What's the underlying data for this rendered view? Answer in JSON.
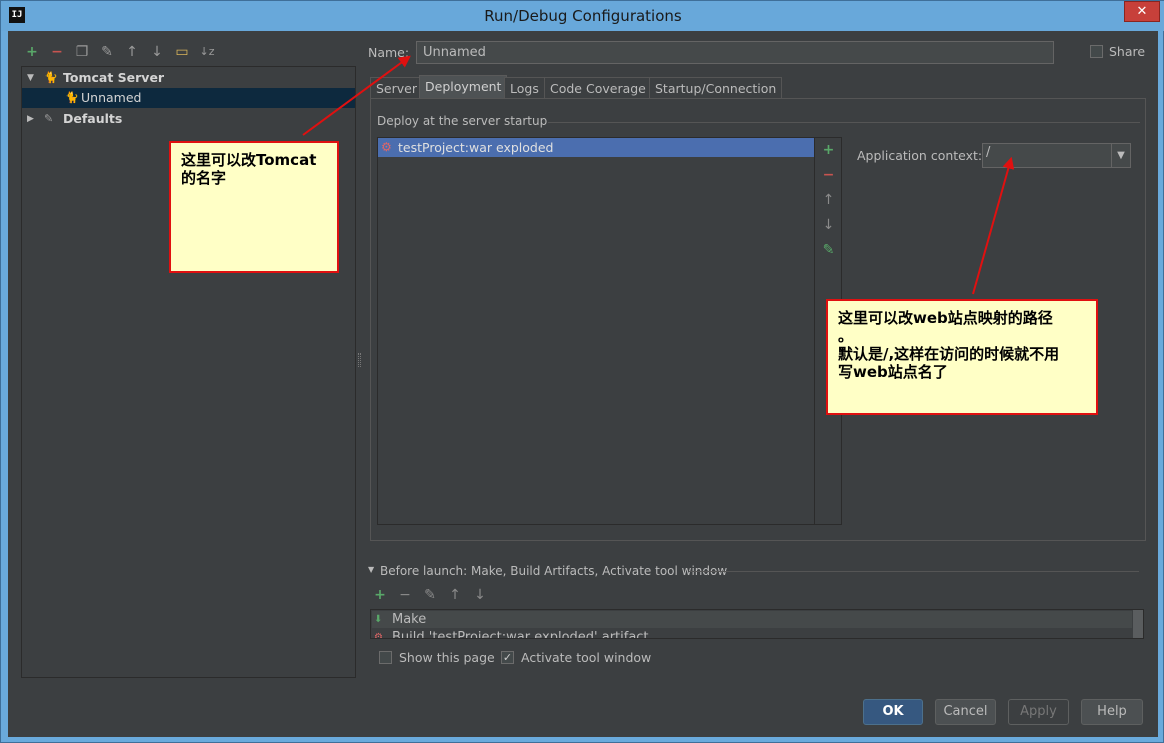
{
  "window": {
    "title": "Run/Debug Configurations",
    "app_icon": "IJ",
    "close_glyph": "✕"
  },
  "tree": {
    "items": [
      {
        "label": "Tomcat Server",
        "expanded": true
      },
      {
        "label": "Unnamed",
        "selected": true
      },
      {
        "label": "Defaults",
        "expanded": false
      }
    ]
  },
  "form": {
    "name_label": "Name:",
    "name_value": "Unnamed",
    "share_label": "Share",
    "tabs": [
      "Server",
      "Deployment",
      "Logs",
      "Code Coverage",
      "Startup/Connection"
    ],
    "active_tab": "Deployment",
    "deploy_section_label": "Deploy at the server startup",
    "deploy_items": [
      "testProject:war exploded"
    ],
    "app_context_label": "Application context:",
    "app_context_value": "/"
  },
  "before_launch": {
    "title": "Before launch: Make, Build Artifacts, Activate tool window",
    "tasks": [
      "Make",
      "Build 'testProject:war exploded' artifact"
    ],
    "show_this_page_label": "Show this page",
    "show_this_page_checked": false,
    "activate_tool_window_label": "Activate tool window",
    "activate_tool_window_checked": true
  },
  "buttons": {
    "ok": "OK",
    "cancel": "Cancel",
    "apply": "Apply",
    "help": "Help"
  },
  "annotations": {
    "note1_line1": "这里可以改Tomcat",
    "note1_line2": "的名字",
    "note2_line1": "这里可以改web站点映射的路径",
    "note2_line2": "。",
    "note2_line3": "默认是/,这样在访问的时候就不用",
    "note2_line4": "写web站点名了"
  },
  "colors": {
    "accent": "#4b6eaf",
    "annotation_border": "#e01010",
    "annotation_bg": "#ffffc6"
  }
}
